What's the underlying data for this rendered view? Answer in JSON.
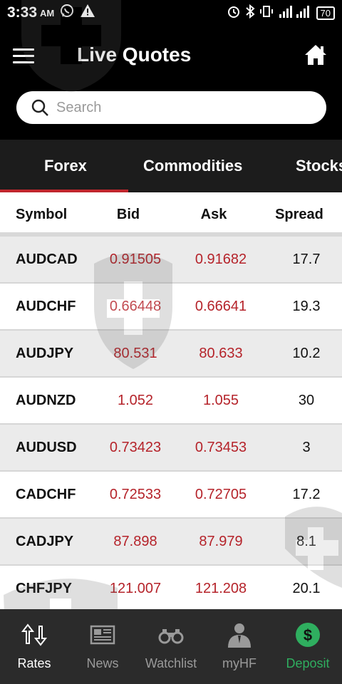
{
  "status_bar": {
    "time": "3:33",
    "ampm": "AM",
    "battery": "70"
  },
  "header": {
    "title": "Live Quotes"
  },
  "search": {
    "placeholder": "Search"
  },
  "tabs": [
    {
      "label": "Forex",
      "active": true
    },
    {
      "label": "Commodities",
      "active": false
    },
    {
      "label": "Stocks",
      "active": false
    }
  ],
  "table": {
    "headers": {
      "symbol": "Symbol",
      "bid": "Bid",
      "ask": "Ask",
      "spread": "Spread"
    },
    "rows": [
      {
        "symbol": "AUDCAD",
        "bid": "0.91505",
        "ask": "0.91682",
        "spread": "17.7"
      },
      {
        "symbol": "AUDCHF",
        "bid": "0.66448",
        "ask": "0.66641",
        "spread": "19.3"
      },
      {
        "symbol": "AUDJPY",
        "bid": "80.531",
        "ask": "80.633",
        "spread": "10.2"
      },
      {
        "symbol": "AUDNZD",
        "bid": "1.052",
        "ask": "1.055",
        "spread": "30"
      },
      {
        "symbol": "AUDUSD",
        "bid": "0.73423",
        "ask": "0.73453",
        "spread": "3"
      },
      {
        "symbol": "CADCHF",
        "bid": "0.72533",
        "ask": "0.72705",
        "spread": "17.2"
      },
      {
        "symbol": "CADJPY",
        "bid": "87.898",
        "ask": "87.979",
        "spread": "8.1"
      },
      {
        "symbol": "CHFJPY",
        "bid": "121.007",
        "ask": "121.208",
        "spread": "20.1"
      }
    ]
  },
  "bottom_nav": [
    {
      "label": "Rates",
      "icon": "rates-arrows-icon",
      "active": true
    },
    {
      "label": "News",
      "icon": "newspaper-icon",
      "active": false
    },
    {
      "label": "Watchlist",
      "icon": "binoculars-icon",
      "active": false
    },
    {
      "label": "myHF",
      "icon": "person-icon",
      "active": false
    },
    {
      "label": "Deposit",
      "icon": "dollar-circle-icon",
      "active": false
    }
  ],
  "colors": {
    "accent_red": "#c0262d",
    "price_red": "#b5232a",
    "deposit_green": "#2fae5f",
    "nav_bg": "#2b2b2b",
    "tab_bg": "#1c1c1c"
  }
}
